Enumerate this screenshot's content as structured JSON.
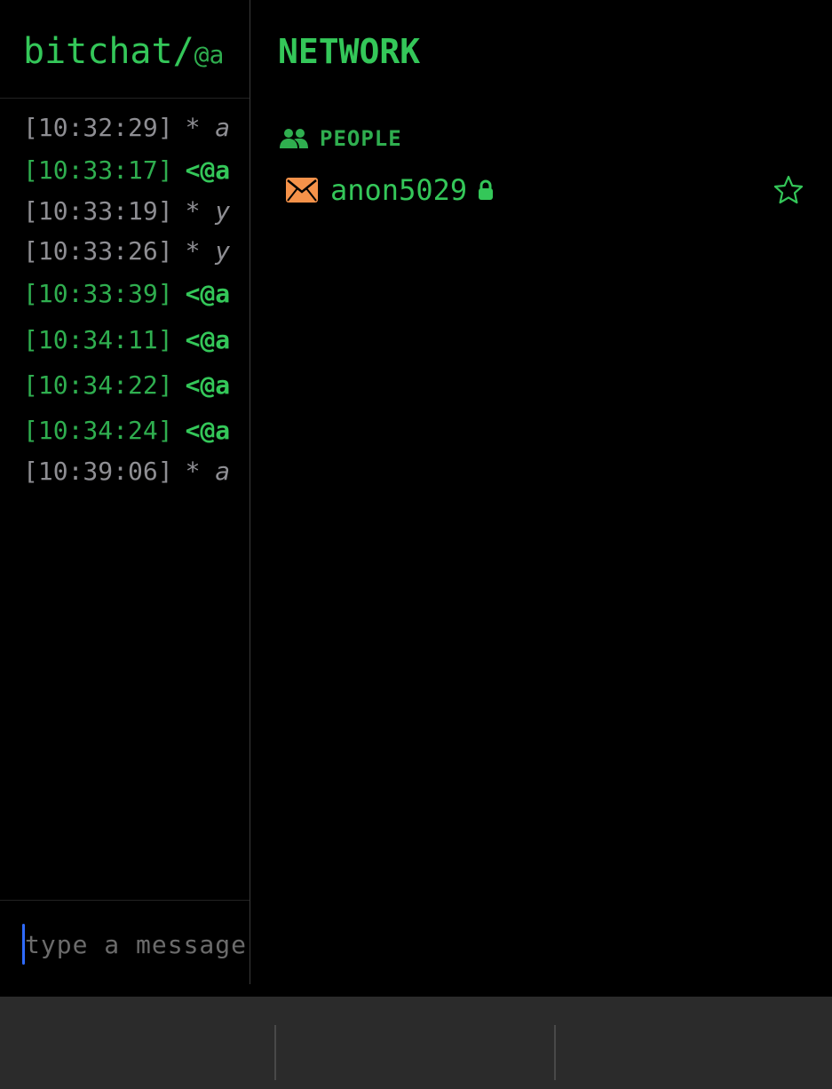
{
  "chat": {
    "title": "bitchat/",
    "nick_fragment": "@a",
    "messages": [
      {
        "time": "[10:32:29]",
        "text": "* a",
        "kind": "system"
      },
      {
        "time": "[10:33:17]",
        "text": "<@a",
        "kind": "green"
      },
      {
        "time": "[10:33:19]",
        "text": "* y",
        "kind": "system"
      },
      {
        "time": "[10:33:26]",
        "text": "* y",
        "kind": "system"
      },
      {
        "time": "[10:33:39]",
        "text": "<@a",
        "kind": "green"
      },
      {
        "time": "[10:34:11]",
        "text": "<@a",
        "kind": "green"
      },
      {
        "time": "[10:34:22]",
        "text": "<@a",
        "kind": "green"
      },
      {
        "time": "[10:34:24]",
        "text": "<@a",
        "kind": "green"
      },
      {
        "time": "[10:39:06]",
        "text": "* a",
        "kind": "system"
      }
    ],
    "input_placeholder": "type a message"
  },
  "sidebar": {
    "title": "NETWORK",
    "section_label": "PEOPLE",
    "section_icon": "people-icon",
    "peers": [
      {
        "name": "anon5029",
        "icon": "envelope-icon",
        "status_icon": "lock-icon",
        "favorite_icon": "star-outline-icon"
      }
    ]
  },
  "colors": {
    "accent_green": "#34c759",
    "dim_green": "#2fae4f",
    "envelope_orange": "#f5924a",
    "muted_text": "#8e8e93",
    "caret_blue": "#2f6bff",
    "toolbar_bg": "#2b2b2b"
  }
}
